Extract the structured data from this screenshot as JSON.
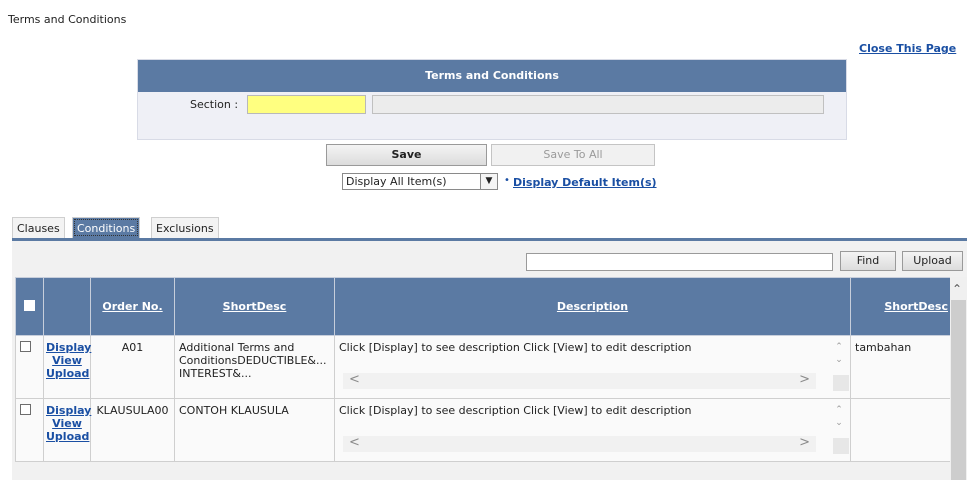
{
  "page": {
    "title": "Terms and Conditions",
    "close_link": "Close This Page"
  },
  "panel": {
    "header": "Terms and Conditions",
    "section_label": "Section :",
    "section_code_value": "",
    "section_name_value": ""
  },
  "buttons": {
    "save": "Save",
    "save_to_all": "Save To All",
    "find": "Find",
    "upload": "Upload"
  },
  "display_filter": {
    "selected": "Display All Item(s)",
    "default_link": "Display Default Item(s)"
  },
  "tabs": [
    {
      "label": "Clauses",
      "active": false
    },
    {
      "label": "Conditions",
      "active": true
    },
    {
      "label": "Exclusions",
      "active": false
    }
  ],
  "search": {
    "value": ""
  },
  "table": {
    "columns": [
      "",
      "",
      "Order No.",
      "ShortDesc",
      "Description",
      "ShortDesc"
    ],
    "rows": [
      {
        "actions": [
          "Display",
          "View",
          "Upload"
        ],
        "order_no": "A01",
        "short_desc": "Additional Terms and ConditionsDEDUCTIBLE&... INTEREST&...",
        "description": "Click [Display] to see description Click [View] to edit description",
        "short_desc2": "tambahan"
      },
      {
        "actions": [
          "Display",
          "View",
          "Upload"
        ],
        "order_no": "KLAUSULA00",
        "short_desc": "CONTOH KLAUSULA",
        "description": "Click [Display] to see description Click [View] to edit description",
        "short_desc2": ""
      }
    ]
  },
  "colors": {
    "header_blue": "#5b7aa3",
    "link_blue": "#1a4fa3",
    "required_yellow": "#ffff80"
  }
}
